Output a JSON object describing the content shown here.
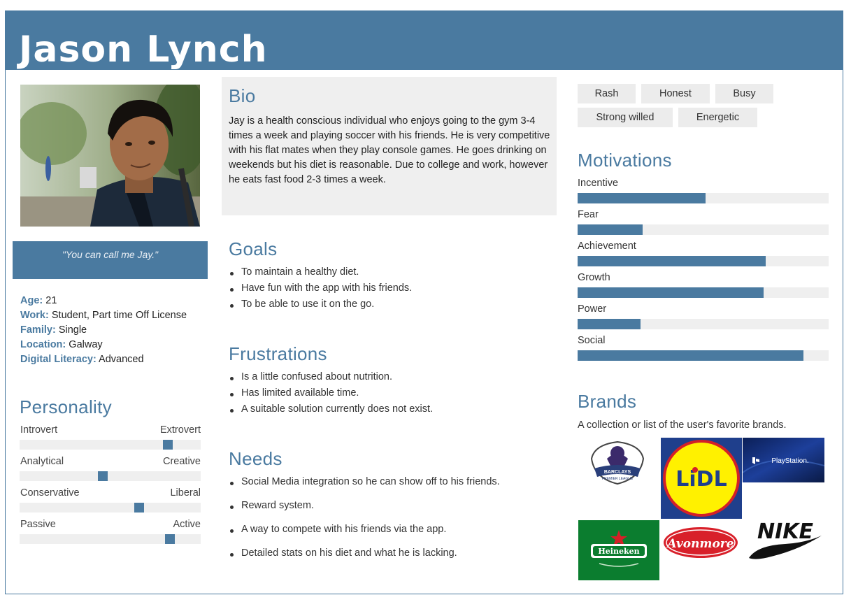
{
  "header": {
    "name": "Jason Lynch"
  },
  "quote": "\"You can call me Jay.\"",
  "facts": [
    {
      "key": "Age",
      "value": "21"
    },
    {
      "key": "Work",
      "value": "Student, Part time Off License"
    },
    {
      "key": "Family",
      "value": "Single"
    },
    {
      "key": "Location",
      "value": "Galway"
    },
    {
      "key": "Digital Literacy",
      "value": "Advanced"
    }
  ],
  "personality": {
    "title": "Personality",
    "scales": [
      {
        "left": "Introvert",
        "right": "Extrovert",
        "value": 0.82
      },
      {
        "left": "Analytical",
        "right": "Creative",
        "value": 0.46
      },
      {
        "left": "Conservative",
        "right": "Liberal",
        "value": 0.66
      },
      {
        "left": "Passive",
        "right": "Active",
        "value": 0.83
      }
    ]
  },
  "bio": {
    "title": "Bio",
    "text": "Jay is a health conscious individual who enjoys going to the gym 3-4 times a week and playing soccer with his friends. He is very competitive with his flat mates when they play console games. He goes drinking on weekends but his diet is reasonable. Due to college and work, however he eats fast food 2-3 times a week."
  },
  "goals": {
    "title": "Goals",
    "items": [
      "To maintain a healthy diet.",
      "Have fun with the app with his friends.",
      "To be able to use it on the go."
    ]
  },
  "frustrations": {
    "title": "Frustrations",
    "items": [
      "Is a little confused about nutrition.",
      "Has limited available time.",
      "A suitable solution currently does not exist."
    ]
  },
  "needs": {
    "title": "Needs",
    "items": [
      "Social Media integration so he can show off to his friends.",
      "Reward system.",
      "A way to compete with his friends via the app.",
      "Detailed stats on his diet and what he is lacking."
    ]
  },
  "traits": [
    "Rash",
    "Honest",
    "Busy",
    "Strong willed",
    "Energetic"
  ],
  "motivations": {
    "title": "Motivations",
    "items": [
      {
        "label": "Incentive",
        "value": 0.51
      },
      {
        "label": "Fear",
        "value": 0.26
      },
      {
        "label": "Achievement",
        "value": 0.75
      },
      {
        "label": "Growth",
        "value": 0.74
      },
      {
        "label": "Power",
        "value": 0.25
      },
      {
        "label": "Social",
        "value": 0.9
      }
    ]
  },
  "brands": {
    "title": "Brands",
    "description": "A collection or list of the user's favorite brands.",
    "logos": [
      {
        "name": "barclays-premier-league",
        "text": "BARCLAYS PREMIER LEAGUE"
      },
      {
        "name": "lidl",
        "text": "LiDL"
      },
      {
        "name": "playstation",
        "text": "PlayStation."
      },
      {
        "name": "heineken",
        "text": "Heineken"
      },
      {
        "name": "avonmore",
        "text": "Avonmore"
      },
      {
        "name": "nike",
        "text": "NIKE"
      }
    ]
  },
  "colors": {
    "accent": "#4a7aa0",
    "panel": "#efefef"
  }
}
